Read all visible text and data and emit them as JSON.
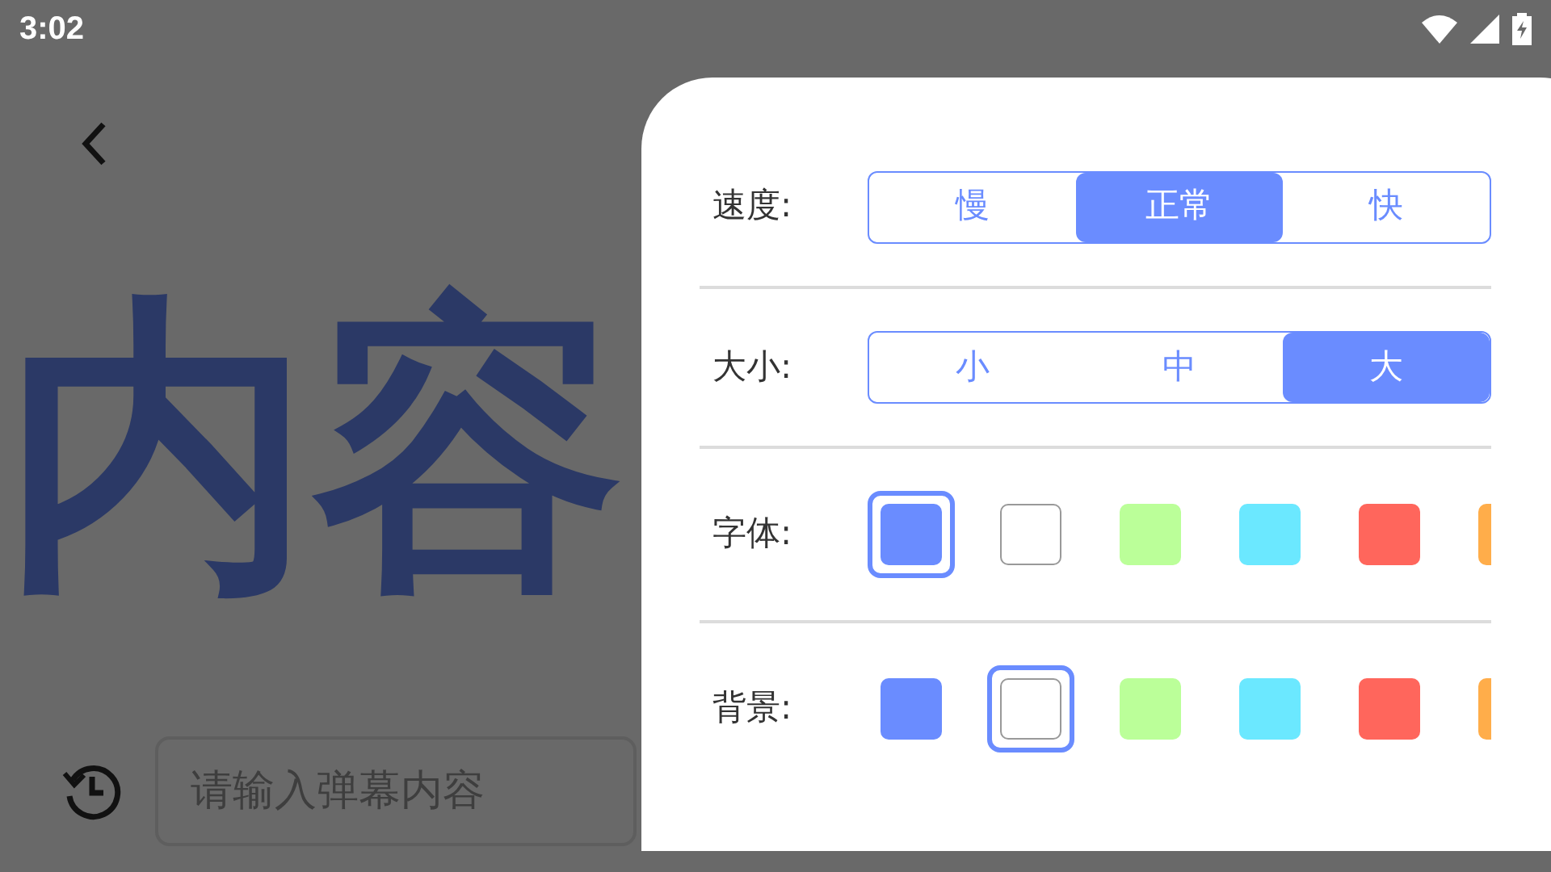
{
  "status_bar": {
    "time": "3:02"
  },
  "preview": {
    "text": "内容"
  },
  "input": {
    "placeholder": "请输入弹幕内容"
  },
  "settings": [
    {
      "kind": "segments",
      "label": "速度:",
      "options": [
        {
          "label": "慢",
          "selected": false
        },
        {
          "label": "正常",
          "selected": true
        },
        {
          "label": "快",
          "selected": false
        }
      ]
    },
    {
      "kind": "segments",
      "label": "大小:",
      "options": [
        {
          "label": "小",
          "selected": false
        },
        {
          "label": "中",
          "selected": false
        },
        {
          "label": "大",
          "selected": true
        }
      ]
    },
    {
      "kind": "swatches",
      "label": "字体:",
      "options": [
        {
          "color": "#6a8cff",
          "selected": true
        },
        {
          "color": "#ffffff",
          "selected": false
        },
        {
          "color": "#bbff99",
          "selected": false
        },
        {
          "color": "#6be8ff",
          "selected": false
        },
        {
          "color": "#ff665c",
          "selected": false
        },
        {
          "color": "#ffad4a",
          "selected": false
        }
      ]
    },
    {
      "kind": "swatches",
      "label": "背景:",
      "options": [
        {
          "color": "#6a8cff",
          "selected": false
        },
        {
          "color": "#ffffff",
          "selected": true
        },
        {
          "color": "#bbff99",
          "selected": false
        },
        {
          "color": "#6be8ff",
          "selected": false
        },
        {
          "color": "#ff665c",
          "selected": false
        },
        {
          "color": "#ffad4a",
          "selected": false
        }
      ]
    }
  ]
}
